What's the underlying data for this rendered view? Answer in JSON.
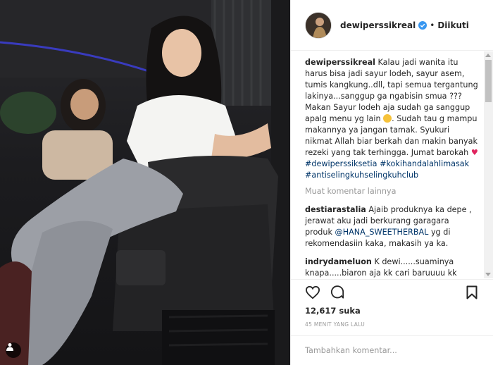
{
  "post": {
    "username": "dewiperssikreal",
    "follow_status": "Diikuti",
    "dot": "•",
    "caption": {
      "user": "dewiperssikreal",
      "text1": "Kalau jadi wanita itu harus bisa jadi sayur lodeh, sayur asem, tumis kangkung..dll, tapi semua tergantung lakinya...sanggup ga ngabisin smua ??? Makan Sayur lodeh aja sudah ga sanggup apalg menu yg lain",
      "text2": ". Sudah tau g mampu makannya ya jangan tamak. Syukuri nikmat Allah biar berkah dan makin banyak rezeki yang tak terhingga. Jumat barokah",
      "heart": "♥",
      "tags": [
        "#dewiperssiksetia",
        "#kokihandalahlimasak",
        "#antiselingkuhselingkuhclub"
      ]
    },
    "load_more": "Muat komentar lainnya",
    "comments": [
      {
        "user": "destiarastalia",
        "text1": "Ajaib produknya ka depe , jerawat aku jadi berkurang garagara produk",
        "mention": "@HANA_SWEETHERBAL",
        "text2": "yg di rekomendasiin kaka, makasih ya ka."
      },
      {
        "user": "indrydameluon",
        "text1": "K dewi......suaminya knapa.....biaron aja kk cari baruuuu kk",
        "mention": "",
        "text2": ""
      }
    ],
    "likes": "12,617 suka",
    "time": "45 MENIT YANG LALU",
    "comment_placeholder": "Tambahkan komentar..."
  },
  "icons": {
    "like": "heart-outline-icon",
    "comment": "speech-bubble-icon",
    "save": "bookmark-icon",
    "verified": "verified-badge-icon",
    "more": "ellipsis-icon",
    "user_tag": "person-icon"
  },
  "colors": {
    "link": "#003569",
    "heart": "#e0245e",
    "verified": "#3897f0",
    "muted": "#999999"
  }
}
